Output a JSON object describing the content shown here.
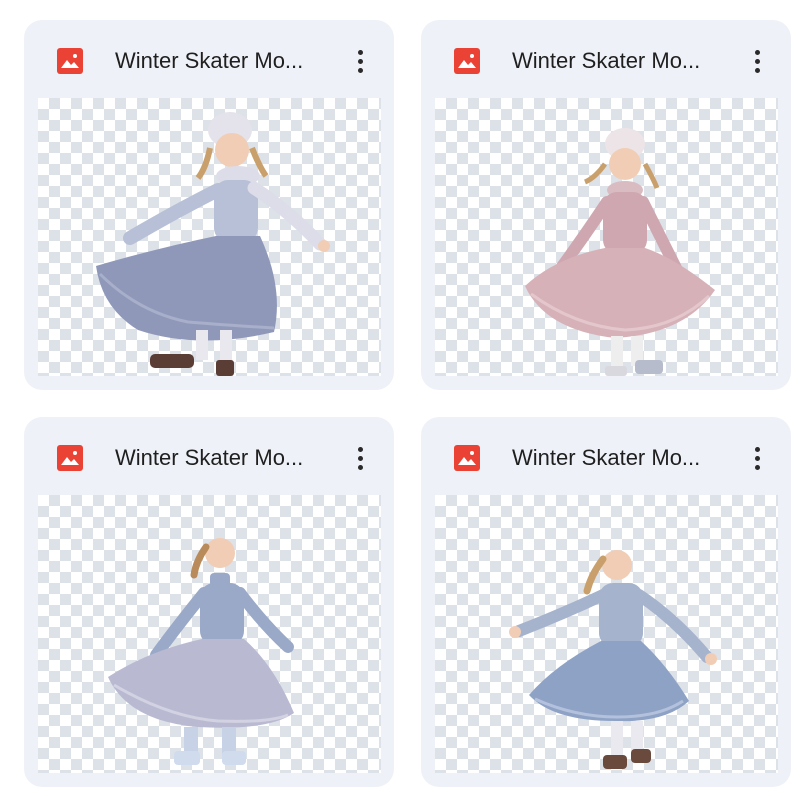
{
  "files": [
    {
      "title": "Winter Skater Mo...",
      "type_icon": "image-file-icon",
      "dress_color": "#8f98b8",
      "top_color": "#b7c0d6"
    },
    {
      "title": "Winter Skater Mo...",
      "type_icon": "image-file-icon",
      "dress_color": "#d6b2b8",
      "top_color": "#cfa7b0"
    },
    {
      "title": "Winter Skater Mo...",
      "type_icon": "image-file-icon",
      "dress_color": "#b9b9d2",
      "top_color": "#9aa9c8"
    },
    {
      "title": "Winter Skater Mo...",
      "type_icon": "image-file-icon",
      "dress_color": "#8ea2c6",
      "top_color": "#a6b3cd"
    }
  ],
  "colors": {
    "card_bg": "#eef1f7",
    "icon_red": "#ea4335"
  }
}
